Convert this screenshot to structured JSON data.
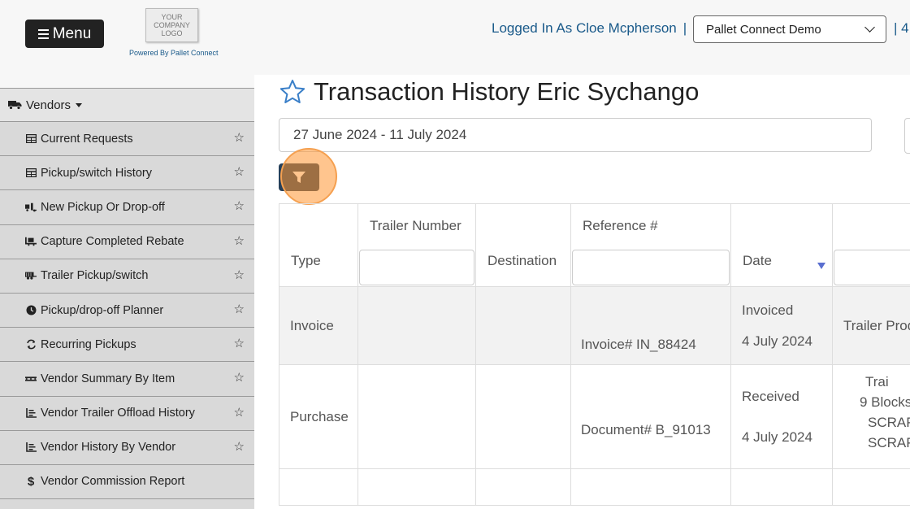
{
  "header": {
    "menu_label": "Menu",
    "logo_lines": [
      "YOUR",
      "COMPANY",
      "LOGO"
    ],
    "powered_by": "Powered By Pallet Connect",
    "logged_in": "Logged In As Cloe Mcpherson",
    "separator": "|",
    "company_selected": "Pallet Connect Demo",
    "extra_text": "| 4"
  },
  "sidebar": {
    "section_label": "Vendors",
    "items": [
      {
        "label": "Current Requests",
        "icon": "table-icon"
      },
      {
        "label": "Pickup/switch History",
        "icon": "table-icon"
      },
      {
        "label": "New Pickup Or Drop-off",
        "icon": "truck-loading-icon"
      },
      {
        "label": "Capture Completed Rebate",
        "icon": "pallet-icon"
      },
      {
        "label": "Trailer Pickup/switch",
        "icon": "trailer-icon"
      },
      {
        "label": "Pickup/drop-off Planner",
        "icon": "clock-icon"
      },
      {
        "label": "Recurring Pickups",
        "icon": "recurring-icon"
      },
      {
        "label": "Vendor Summary By Item",
        "icon": "pallet-icon"
      },
      {
        "label": "Vendor Trailer Offload History",
        "icon": "chart-icon"
      },
      {
        "label": "Vendor History By Vendor",
        "icon": "chart-icon"
      },
      {
        "label": "Vendor Commission Report",
        "icon": "dollar-icon"
      }
    ]
  },
  "page": {
    "title": "Transaction History Eric Sychango",
    "date_range": "27 June 2024 - 11 July 2024"
  },
  "table": {
    "columns": [
      "Type",
      "Trailer Number",
      "Destination",
      "Reference #",
      "Date",
      ""
    ],
    "rows": [
      {
        "type": "Invoice",
        "trailer": "",
        "destination": "",
        "reference": "Invoice# IN_88424",
        "date_status": "Invoiced",
        "date": "4 July 2024",
        "product_lines": [
          "Trailer Prod"
        ]
      },
      {
        "type": "Purchase",
        "trailer": "",
        "destination": "",
        "reference": "Document# B_91013",
        "date_status": "Received",
        "date": "4 July 2024",
        "product_lines": [
          "Trai",
          "9 Blocks",
          "SCRAP",
          "SCRAP"
        ]
      }
    ]
  }
}
